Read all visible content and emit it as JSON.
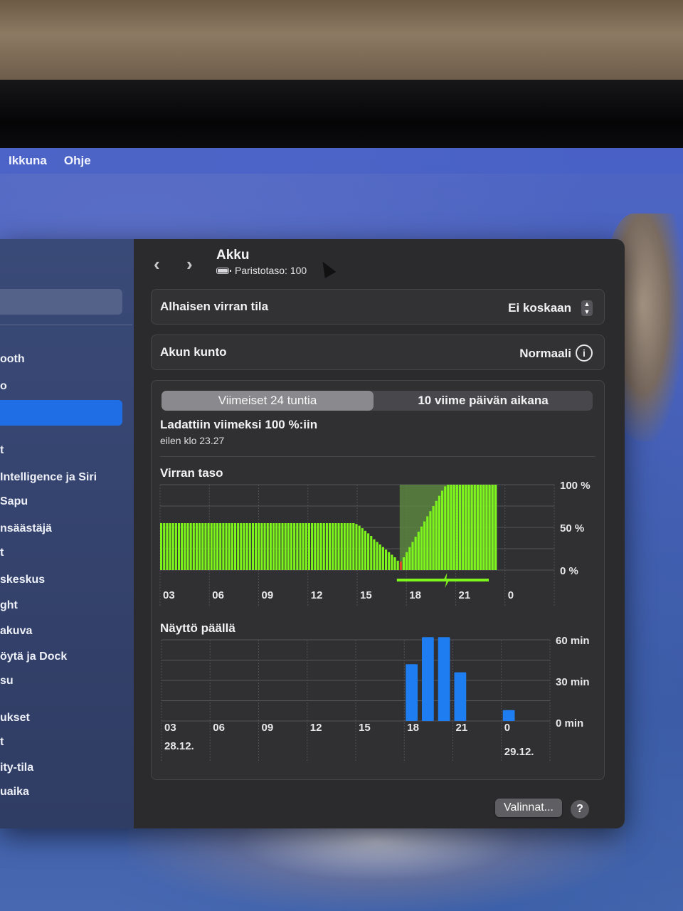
{
  "menubar": {
    "items": [
      "Ikkuna",
      "Ohje"
    ]
  },
  "sidebar": {
    "items": [
      {
        "label": "ooth"
      },
      {
        "label": "o"
      },
      {
        "label": "t"
      },
      {
        "label": " Intelligence ja Siri"
      },
      {
        "label": "Sapu"
      },
      {
        "label": "nsäästäjä"
      },
      {
        "label": "t"
      },
      {
        "label": "skeskus"
      },
      {
        "label": "ght"
      },
      {
        "label": "akuva"
      },
      {
        "label": "öytä ja Dock"
      },
      {
        "label": "su"
      },
      {
        "label": "ukset"
      },
      {
        "label": "t"
      },
      {
        "label": "ity-tila"
      },
      {
        "label": "uaika"
      }
    ]
  },
  "header": {
    "back": "‹",
    "forward": "›",
    "title": "Akku",
    "subtitle": "Paristotaso: 100"
  },
  "rows": {
    "low_power": {
      "label": "Alhaisen virran tila",
      "value": "Ei koskaan"
    },
    "health": {
      "label": "Akun kunto",
      "value": "Normaali",
      "info_icon": "i"
    }
  },
  "usage": {
    "tabs": [
      "Viimeiset 24 tuntia",
      "10 viime päivän aikana"
    ],
    "selected_tab": 0,
    "last_charged": "Ladattiin viimeksi 100 %:iin",
    "last_charged_time": "eilen klo 23.27"
  },
  "colors": {
    "battery_green": "#7ef51c",
    "low_red": "#e0452a",
    "screen_blue": "#1e7df0",
    "charge_shade": "#5d8a3e"
  },
  "chart_data": [
    {
      "type": "bar",
      "title": "Virran taso",
      "x_tick_labels": [
        "03",
        "06",
        "09",
        "12",
        "15",
        "18",
        "21",
        "0"
      ],
      "y_tick_labels": [
        "100 %",
        "50 %",
        "0 %"
      ],
      "ylim": [
        0,
        100
      ],
      "series": [
        {
          "values": [
            55,
            55,
            55,
            55,
            55,
            55,
            55,
            55,
            55,
            55,
            55,
            55,
            55,
            55,
            55,
            55,
            55,
            55,
            55,
            55,
            55,
            55,
            55,
            55,
            55,
            55,
            55,
            55,
            55,
            55,
            55,
            55,
            55,
            55,
            55,
            55,
            55,
            55,
            55,
            55,
            55,
            55,
            55,
            55,
            55,
            55,
            55,
            55,
            55,
            55,
            55,
            55,
            55,
            55,
            55,
            55,
            55,
            55,
            55,
            55,
            55,
            55,
            55,
            55,
            55,
            55,
            54,
            52,
            49,
            46,
            43,
            40,
            36,
            33,
            30,
            27,
            24,
            21,
            18,
            15,
            11,
            10,
            15,
            21,
            27,
            33,
            39,
            45,
            51,
            57,
            63,
            69,
            75,
            81,
            87,
            93,
            98,
            100,
            100,
            100,
            100,
            100,
            100,
            100,
            100,
            100,
            100,
            100,
            100,
            100,
            100,
            100,
            100,
            100
          ]
        }
      ],
      "low_point_index": 81,
      "charging_from_index": 81,
      "grid": true,
      "legend": "none"
    },
    {
      "type": "bar",
      "title": "Näyttö päällä",
      "x_tick_labels": [
        "03",
        "06",
        "09",
        "12",
        "15",
        "18",
        "21",
        "0"
      ],
      "date_labels": [
        "28.12.",
        "29.12."
      ],
      "y_tick_labels": [
        "60 min",
        "30 min",
        "0 min"
      ],
      "ylim": [
        0,
        60
      ],
      "categories_hours": [
        17,
        18,
        19,
        20,
        23
      ],
      "series": [
        {
          "values": [
            42,
            62,
            62,
            36,
            8
          ]
        }
      ],
      "grid": true,
      "legend": "none"
    }
  ],
  "footer": {
    "options_button": "Valinnat...",
    "help_icon": "?"
  }
}
